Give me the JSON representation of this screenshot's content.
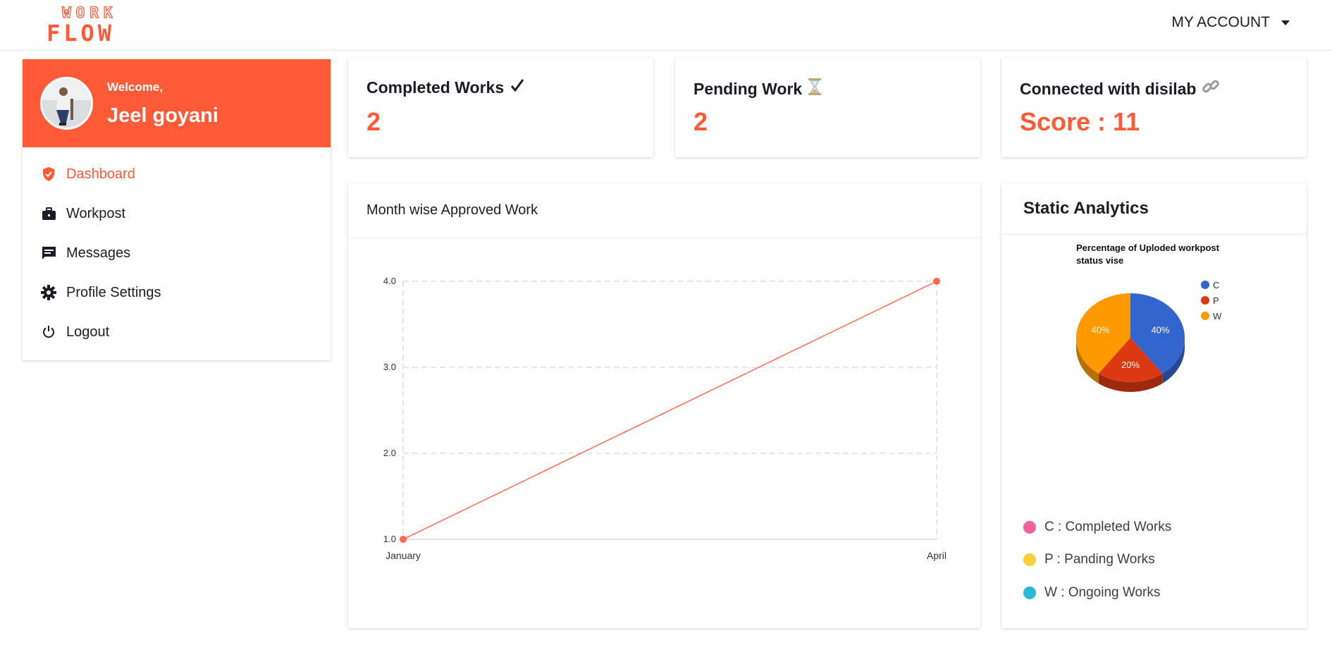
{
  "brand": {
    "line1": "WORK",
    "line2": "FLOW",
    "color": "#ff5a36"
  },
  "header": {
    "account_label": "MY ACCOUNT"
  },
  "sidebar": {
    "welcome": "Welcome,",
    "username": "Jeel goyani",
    "items": [
      {
        "label": "Dashboard",
        "icon": "shield-check-icon",
        "active": true
      },
      {
        "label": "Workpost",
        "icon": "briefcase-icon",
        "active": false
      },
      {
        "label": "Messages",
        "icon": "message-icon",
        "active": false
      },
      {
        "label": "Profile Settings",
        "icon": "gear-icon",
        "active": false
      },
      {
        "label": "Logout",
        "icon": "power-icon",
        "active": false
      }
    ]
  },
  "stats": [
    {
      "label": "Completed Works",
      "icon": "check-icon",
      "value": "2"
    },
    {
      "label": "Pending Work",
      "icon": "hourglass-icon",
      "value": "2"
    },
    {
      "label": "Connected with disilab",
      "icon": "link-icon",
      "value": "Score : 11"
    }
  ],
  "line_panel": {
    "title": "Month wise Approved Work"
  },
  "pie_panel": {
    "title": "Static Analytics",
    "legend": [
      {
        "label": "C : Completed Works",
        "color": "#f0649a"
      },
      {
        "label": "P : Panding Works",
        "color": "#f9cf3a"
      },
      {
        "label": "W : Ongoing Works",
        "color": "#29b9d6"
      }
    ]
  },
  "chart_data": [
    {
      "type": "line",
      "x": [
        "January",
        "April"
      ],
      "series": [
        {
          "values": [
            1.0,
            4.0
          ],
          "color": "#ff6a4d"
        }
      ],
      "yticks": [
        "1.0",
        "2.0",
        "3.0",
        "4.0"
      ],
      "ylim": [
        1.0,
        4.0
      ],
      "grid": true
    },
    {
      "type": "pie",
      "title": "Percentage of Uploded workpost status vise",
      "categories": [
        "C",
        "P",
        "W"
      ],
      "values": [
        40,
        20,
        40
      ],
      "labels": [
        "40%",
        "20%",
        "40%"
      ],
      "colors": [
        "#3366cc",
        "#dc3912",
        "#ff9900"
      ],
      "legend_position": "right"
    }
  ]
}
